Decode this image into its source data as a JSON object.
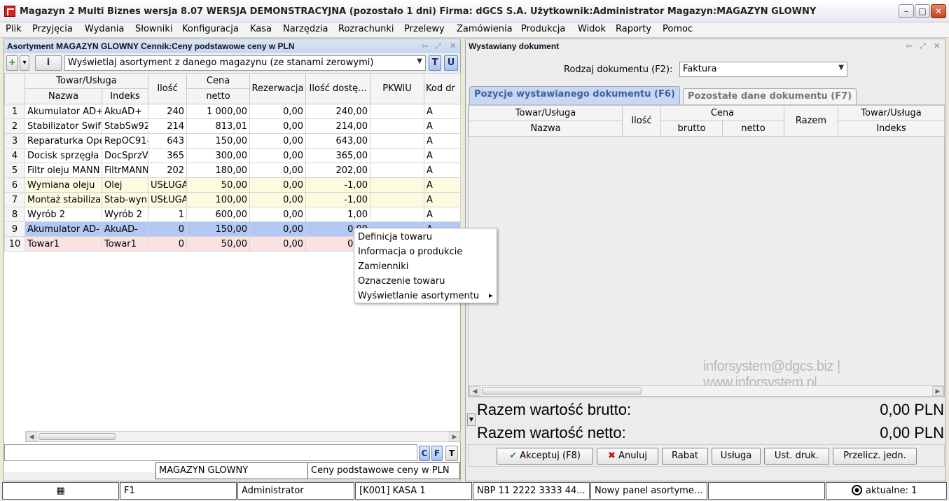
{
  "window": {
    "title": "Magazyn 2 Multi Biznes wersja 8.07  WERSJA DEMONSTRACYJNA (pozostało 1 dni)  Firma: dGCS S.A.    Użytkownik:Administrator    Magazyn:MAGAZYN GLOWNY",
    "minimize": "–",
    "maximize": "□",
    "close": "✕"
  },
  "menu": [
    "Plik",
    "Przyjęcia",
    "Wydania",
    "Słowniki",
    "Konfiguracja",
    "Kasa",
    "Narzędzia",
    "Rozrachunki",
    "Przelewy",
    "Zamówienia",
    "Produkcja",
    "Widok",
    "Raporty",
    "Pomoc"
  ],
  "left_panel": {
    "title": "Asortyment MAGAZYN GLOWNY Cennik:Ceny podstawowe ceny w PLN",
    "filter": "Wyświetlaj asortyment z danego magazynu (ze stanami zerowymi)",
    "btn_add": "+",
    "btn_down": "▾",
    "btn_info": "i",
    "btn_t": "T",
    "btn_u": "U",
    "headers": {
      "group_goods": "Towar/Usługa",
      "name": "Nazwa",
      "index": "Indeks",
      "qty": "Ilość",
      "group_price": "Cena",
      "net": "netto",
      "reservation": "Rezerwacja",
      "available": "Ilość dostę...",
      "pkwiu": "PKWiU",
      "code": "Kod dr"
    },
    "rows": [
      {
        "n": "1",
        "name": "Akumulator AD+",
        "index": "AkuAD+",
        "qty": "240",
        "net": "1 000,00",
        "res": "0,00",
        "avail": "240,00",
        "pkwiu": "",
        "code": "A",
        "style": ""
      },
      {
        "n": "2",
        "name": "Stabilizator Swif",
        "index": "StabSw92",
        "qty": "214",
        "net": "813,01",
        "res": "0,00",
        "avail": "214,00",
        "pkwiu": "",
        "code": "A",
        "style": ""
      },
      {
        "n": "3",
        "name": "Reparaturka Ope",
        "index": "RepOC91-",
        "qty": "643",
        "net": "150,00",
        "res": "0,00",
        "avail": "643,00",
        "pkwiu": "",
        "code": "A",
        "style": ""
      },
      {
        "n": "4",
        "name": "Docisk sprzęgła",
        "index": "DocSprzV",
        "qty": "365",
        "net": "300,00",
        "res": "0,00",
        "avail": "365,00",
        "pkwiu": "",
        "code": "A",
        "style": ""
      },
      {
        "n": "5",
        "name": "Filtr oleju MANN",
        "index": "FiltrMANN",
        "qty": "202",
        "net": "180,00",
        "res": "0,00",
        "avail": "202,00",
        "pkwiu": "",
        "code": "A",
        "style": ""
      },
      {
        "n": "6",
        "name": "Wymiana oleju",
        "index": "Olej",
        "qty": "USŁUGA",
        "net": "50,00",
        "res": "0,00",
        "avail": "-1,00",
        "pkwiu": "",
        "code": "A",
        "style": "yellow"
      },
      {
        "n": "7",
        "name": "Montaż stabiliza",
        "index": "Stab-wyn",
        "qty": "USŁUGA",
        "net": "100,00",
        "res": "0,00",
        "avail": "-1,00",
        "pkwiu": "",
        "code": "A",
        "style": "yellow"
      },
      {
        "n": "8",
        "name": "Wyrób 2",
        "index": "Wyrób 2",
        "qty": "1",
        "net": "600,00",
        "res": "0,00",
        "avail": "1,00",
        "pkwiu": "",
        "code": "A",
        "style": ""
      },
      {
        "n": "9",
        "name": "Akumulator AD-",
        "index": "AkuAD-",
        "qty": "0",
        "net": "150,00",
        "res": "0,00",
        "avail": "0,00",
        "pkwiu": "",
        "code": "A",
        "style": "blue"
      },
      {
        "n": "10",
        "name": "Towar1",
        "index": "Towar1",
        "qty": "0",
        "net": "50,00",
        "res": "0,00",
        "avail": "0,00",
        "pkwiu": "",
        "code": "A",
        "style": "pink"
      }
    ],
    "btn_c": "C",
    "btn_f": "F",
    "btn_t2": "T",
    "status_warehouse": "MAGAZYN GLOWNY",
    "status_pricelist": "Ceny podstawowe ceny w PLN"
  },
  "context_menu": {
    "items": [
      "Definicja towaru",
      "Informacja o produkcie",
      "Zamienniki",
      "Oznaczenie towaru",
      "Wyświetlanie asortymentu"
    ],
    "submenu_arrow": "▸"
  },
  "right_panel": {
    "title": "Wystawiany dokument",
    "doc_type_label": "Rodzaj dokumentu (F2):",
    "doc_type_value": "Faktura",
    "tab_positions": "Pozycje wystawianego dokumentu (F6)",
    "tab_other": "Pozostałe dane dokumentu (F7)",
    "headers": {
      "group_goods": "Towar/Usługa",
      "name": "Nazwa",
      "qty": "Ilość",
      "group_price": "Cena",
      "gross": "brutto",
      "net": "netto",
      "total": "Razem",
      "group_goods2": "Towar/Usługa",
      "index": "Indeks"
    },
    "watermark": "inforsystem@dgcs.biz   |   www.inforsystem.pl",
    "total_gross_label": "Razem wartość brutto:",
    "total_gross_value": "0,00 PLN",
    "total_net_label": "Razem wartość netto:",
    "total_net_value": "0,00 PLN",
    "buttons": {
      "accept": "Akceptuj (F8)",
      "cancel": "Anuluj",
      "discount": "Rabat",
      "service": "Usługa",
      "print_settings": "Ust. druk.",
      "recalc": "Przelicz. jedn."
    }
  },
  "statusbar": {
    "f1": "F1",
    "user": "Administrator",
    "register": "[K001] KASA 1",
    "bank": "NBP 11 2222 3333 44...",
    "panel": "Nowy panel asortyme...",
    "empty": "",
    "current": "aktualne: 1"
  },
  "colors": {
    "selected_row": "#b4c8f4",
    "service_row": "#fbfbe0",
    "zero_row": "#fbe2e2",
    "active_tab": "#c7d8f4"
  }
}
